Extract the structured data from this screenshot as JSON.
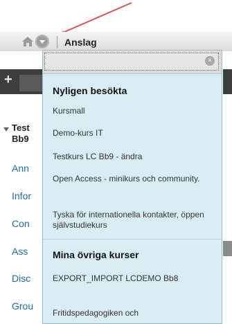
{
  "breadcrumb": {
    "current": "Anslag"
  },
  "course_menu": {
    "course_title": "Test\nBb9",
    "links": [
      "Ann",
      "Infor",
      "Con",
      "Ass",
      "Disc",
      "Grou"
    ]
  },
  "dropdown": {
    "recent_heading": "Nyligen besökta",
    "recent_items": [
      "Kursmall",
      "Demo-kurs IT",
      "Testkurs LC Bb9 - ändra",
      "Open Access - minikurs och community.",
      "Tyska för internationella kontakter, öppen självstudiekurs"
    ],
    "other_heading": "Mina övriga kurser",
    "other_items": [
      "EXPORT_IMPORT LCDEMO Bb8",
      "Fritidspedagogiken och"
    ]
  },
  "colors": {
    "annotation_arrow": "#d9534f",
    "dropdown_bg": "#d9eef4",
    "link": "#1b6fa8"
  },
  "icons": [
    "home-icon",
    "chevron-down-icon",
    "clear-icon",
    "plus-icon",
    "triangle-down-icon"
  ]
}
